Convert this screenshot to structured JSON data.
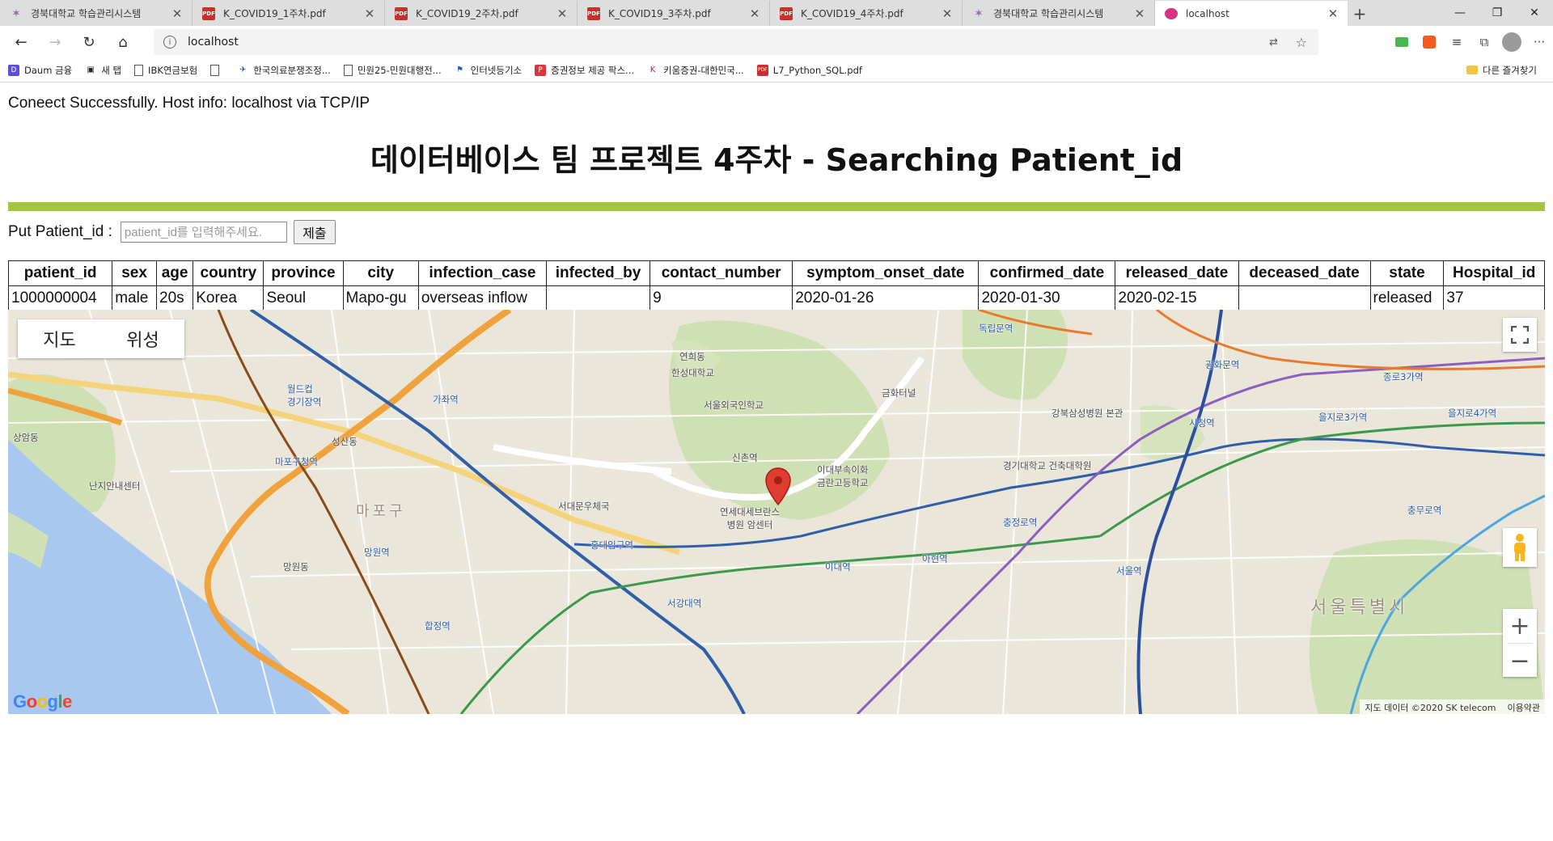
{
  "browser": {
    "tabs": [
      {
        "title": "경북대학교 학습관리시스템",
        "icon": "knu-favicon"
      },
      {
        "title": "K_COVID19_1주차.pdf",
        "icon": "pdf-favicon"
      },
      {
        "title": "K_COVID19_2주차.pdf",
        "icon": "pdf-favicon"
      },
      {
        "title": "K_COVID19_3주차.pdf",
        "icon": "pdf-favicon"
      },
      {
        "title": "K_COVID19_4주차.pdf",
        "icon": "pdf-favicon"
      },
      {
        "title": "경북대학교 학습관리시스템",
        "icon": "knu-favicon"
      },
      {
        "title": "localhost",
        "icon": "edge-favicon",
        "active": true
      }
    ],
    "address": "localhost",
    "bookmarks": [
      {
        "label": "Daum 금융"
      },
      {
        "label": "새 탭"
      },
      {
        "label": "IBK연금보험"
      },
      {
        "label": ""
      },
      {
        "label": "한국의료분쟁조정..."
      },
      {
        "label": "민원25-민원대행전..."
      },
      {
        "label": "인터넷등기소"
      },
      {
        "label": "증권정보 제공 팍스..."
      },
      {
        "label": "키움증권-대한민국..."
      },
      {
        "label": "L7_Python_SQL.pdf"
      }
    ],
    "other_favorites": "다른 즐겨찾기"
  },
  "page": {
    "status": "Coneect Successfully. Host info: localhost via TCP/IP",
    "title": "데이터베이스 팀 프로젝트 4주차 - Searching Patient_id",
    "accent_color": "#a6c640",
    "form": {
      "label": "Put Patient_id :",
      "placeholder": "patient_id를 입력해주세요.",
      "submit": "제출"
    },
    "table": {
      "headers": [
        "patient_id",
        "sex",
        "age",
        "country",
        "province",
        "city",
        "infection_case",
        "infected_by",
        "contact_number",
        "symptom_onset_date",
        "confirmed_date",
        "released_date",
        "deceased_date",
        "state",
        "Hospital_id"
      ],
      "rows": [
        [
          "1000000004",
          "male",
          "20s",
          "Korea",
          "Seoul",
          "Mapo-gu",
          "overseas inflow",
          "",
          "9",
          "2020-01-26",
          "2020-01-30",
          "2020-02-15",
          "",
          "released",
          "37"
        ]
      ]
    }
  },
  "map": {
    "type_buttons": [
      "지도",
      "위성"
    ],
    "attribution": "지도 데이터 ©2020 SK telecom",
    "terms": "이용약관",
    "logo": "Google",
    "labels": {
      "district": "서울특별시",
      "gu": "마포구",
      "hospital": "연세대세브란스\n병원 암센터",
      "sinchon": "신촌역",
      "ewha": "이대부속이화\n금란고등학교",
      "hongdae": "홍대입구역",
      "ahyeon": "아현역",
      "ewha_stn": "이대역",
      "chungjeongno": "충정로역",
      "city_hall": "시청역",
      "gwanghwamun": "광화문역",
      "jongno3": "종로3가역",
      "euljiro3": "을지로3가역",
      "euljiro4": "을지로4가역",
      "chungmuro": "충무로역",
      "mangwon": "망원역",
      "hapjeong": "합정역",
      "seogang": "서강대역",
      "mapo_cheong": "마포구청역",
      "world_cup": "월드컵\n경기장역",
      "gajwa": "가좌역",
      "dokrip": "독립문역",
      "seodaemun": "서대문우체국",
      "nanji": "난지안내센터",
      "seongsan": "성산동",
      "hanseo": "한성대학교",
      "seoul_foreign": "서울외국인학교",
      "geumhwa": "금화터널",
      "gyeonggi_uni": "경기대학교 건축대학원",
      "kangbuk": "강북삼성병원 본관",
      "seoul_station": "서울역",
      "mangwondong": "망원동",
      "yeonhui": "연희동",
      "sangam": "상암동"
    }
  }
}
